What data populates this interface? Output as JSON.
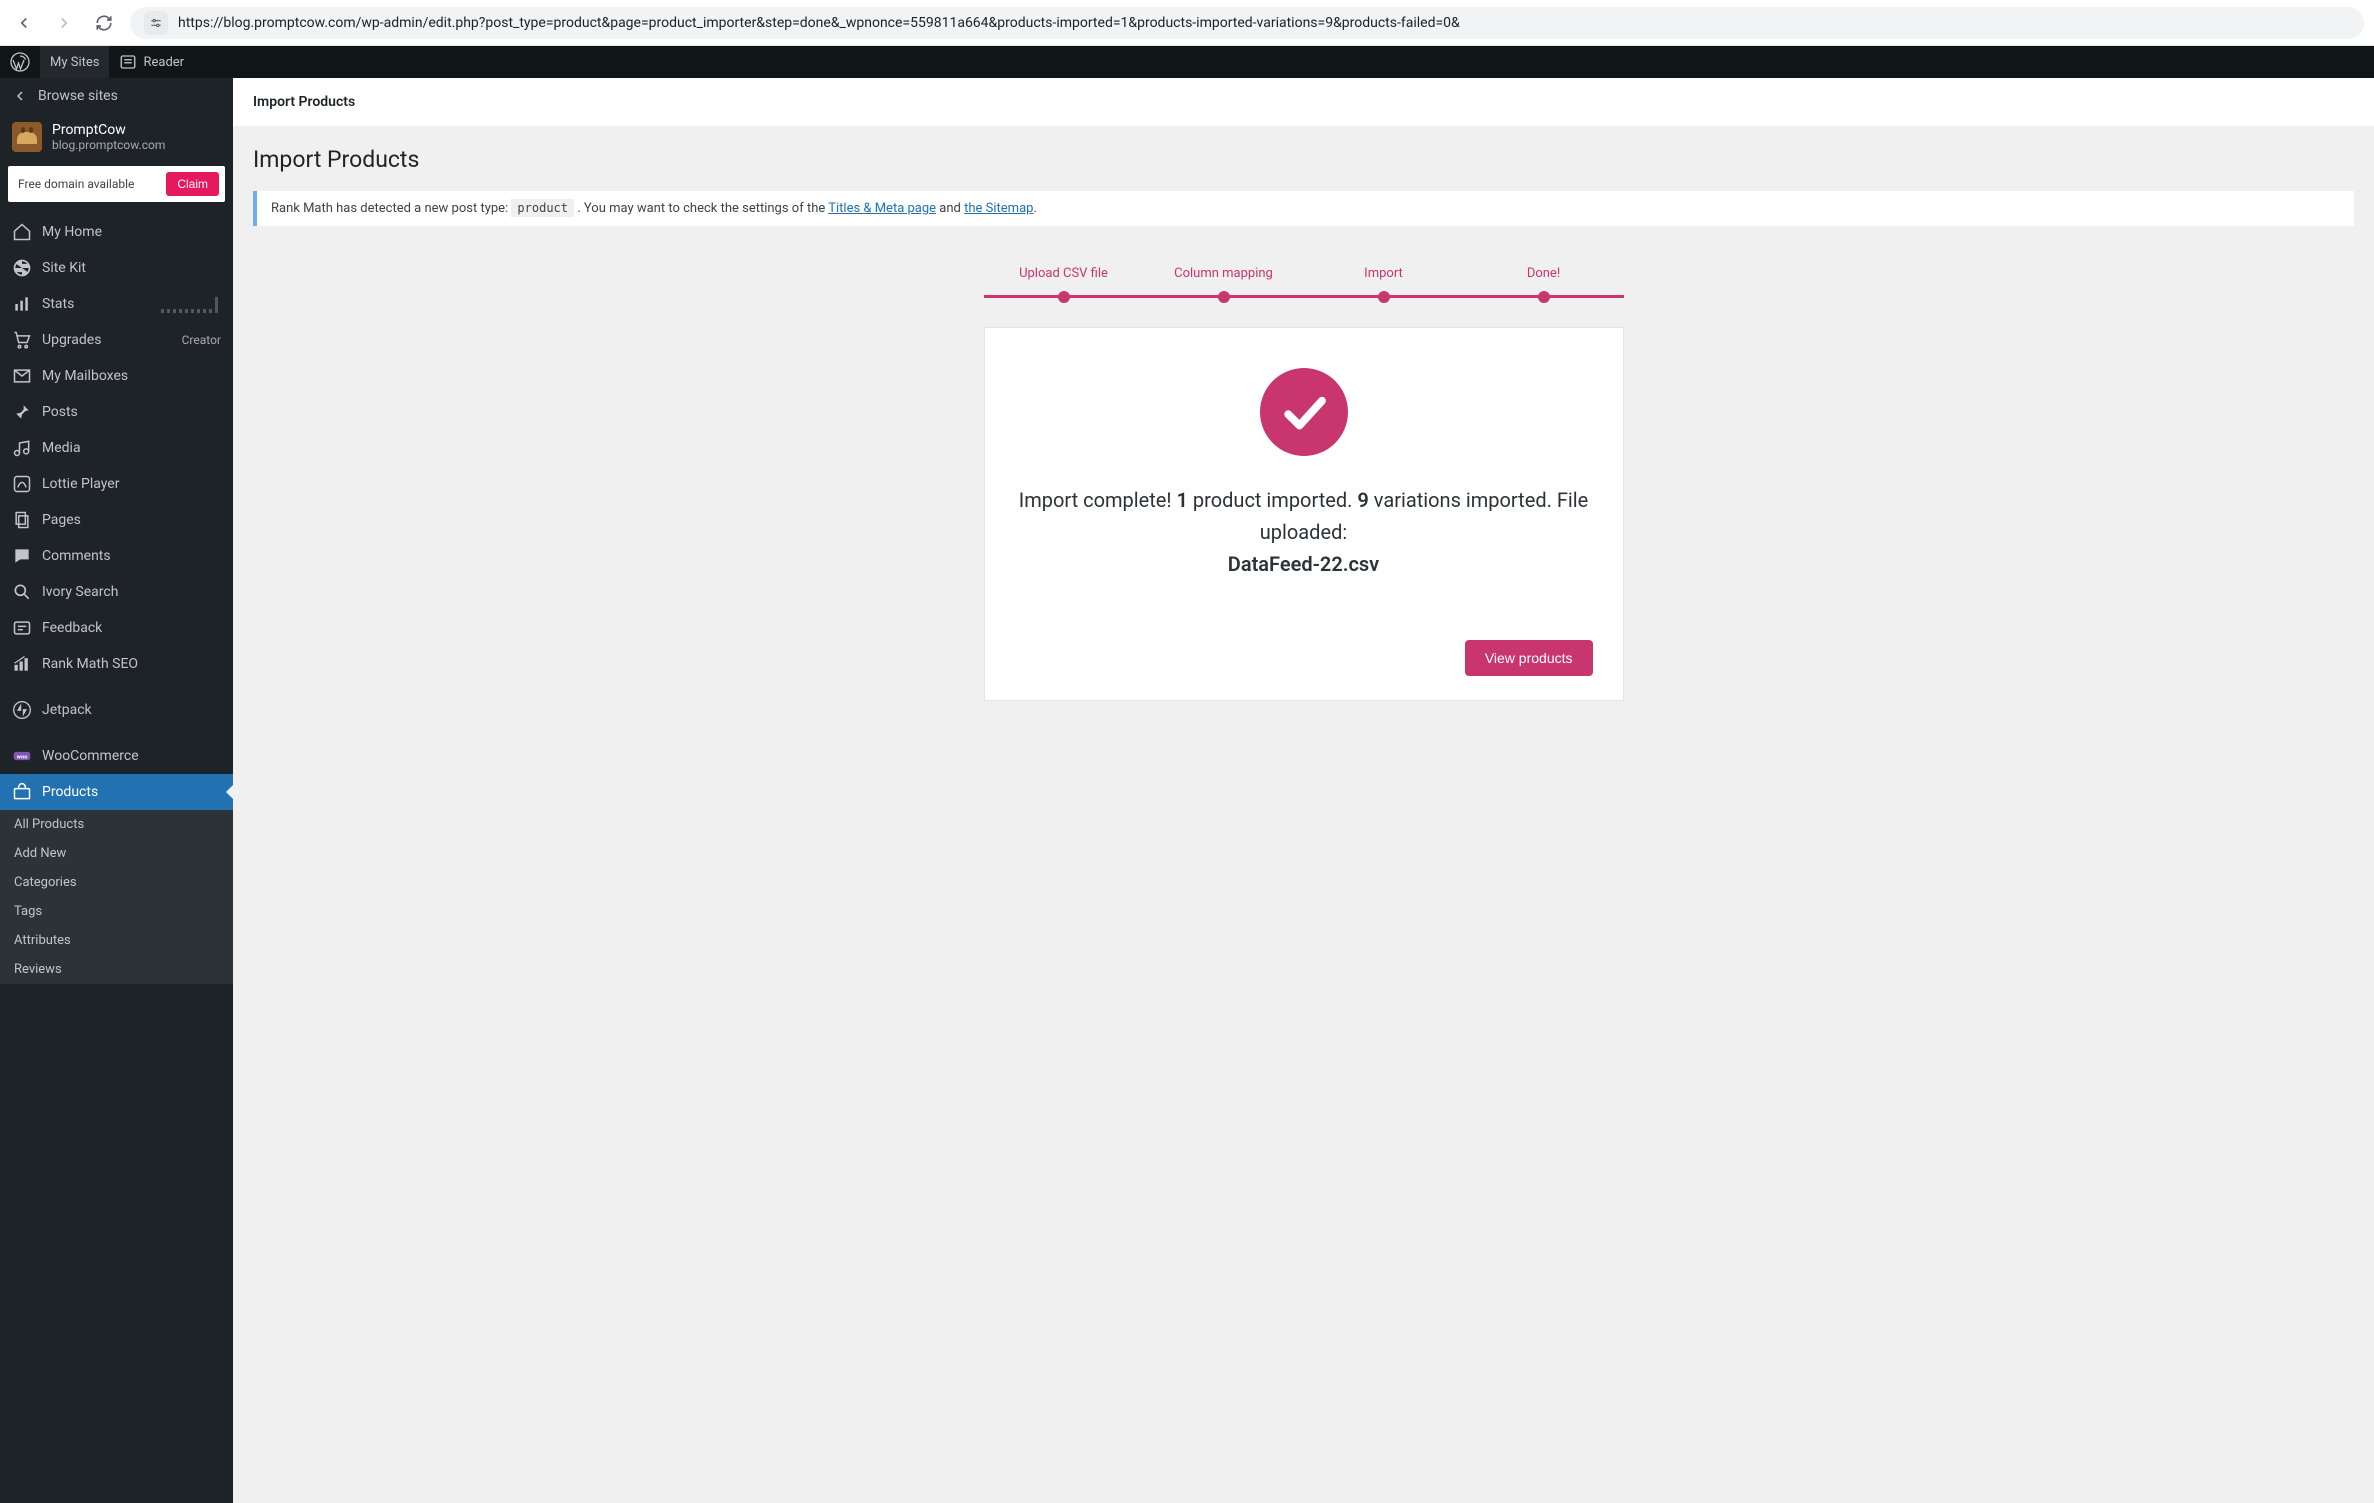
{
  "browser": {
    "url": "https://blog.promptcow.com/wp-admin/edit.php?post_type=product&page=product_importer&step=done&_wpnonce=559811a664&products-imported=1&products-imported-variations=9&products-failed=0&"
  },
  "admin_bar": {
    "my_sites": "My Sites",
    "reader": "Reader"
  },
  "sidebar": {
    "browse": "Browse sites",
    "site_name": "PromptCow",
    "site_sub": "blog.promptcow.com",
    "domain_text": "Free domain available",
    "claim": "Claim",
    "items": [
      {
        "label": "My Home"
      },
      {
        "label": "Site Kit"
      },
      {
        "label": "Stats"
      },
      {
        "label": "Upgrades",
        "right": "Creator"
      },
      {
        "label": "My Mailboxes"
      },
      {
        "label": "Posts"
      },
      {
        "label": "Media"
      },
      {
        "label": "Lottie Player"
      },
      {
        "label": "Pages"
      },
      {
        "label": "Comments"
      },
      {
        "label": "Ivory Search"
      },
      {
        "label": "Feedback"
      },
      {
        "label": "Rank Math SEO"
      },
      {
        "label": "Jetpack"
      },
      {
        "label": "WooCommerce"
      },
      {
        "label": "Products"
      }
    ],
    "submenu": [
      "All Products",
      "Add New",
      "Categories",
      "Tags",
      "Attributes",
      "Reviews"
    ]
  },
  "page": {
    "header": "Import Products",
    "title": "Import Products"
  },
  "notice": {
    "prefix": "Rank Math has detected a new post type: ",
    "code": "product",
    "mid": ". You may want to check the settings of the ",
    "link1": "Titles & Meta page",
    "and": " and ",
    "link2": "the Sitemap",
    "suffix": "."
  },
  "stepper": [
    "Upload CSV file",
    "Column mapping",
    "Import",
    "Done!"
  ],
  "result": {
    "complete": "Import complete! ",
    "products_count": "1",
    "products_text": " product imported. ",
    "variations_count": "9",
    "variations_text": " variations imported. File uploaded: ",
    "filename": "DataFeed-22.csv",
    "view_button": "View products"
  }
}
